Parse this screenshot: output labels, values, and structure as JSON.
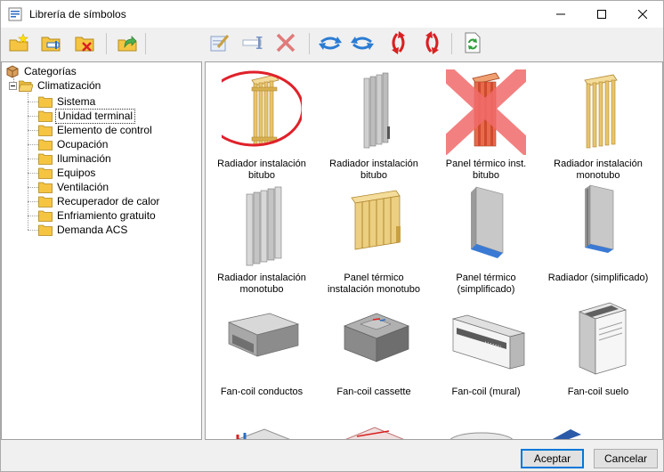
{
  "window": {
    "title": "Librería de símbolos"
  },
  "tree": {
    "root": "Categorías",
    "group": "Climatización",
    "items": [
      "Sistema",
      "Unidad terminal",
      "Elemento de control",
      "Ocupación",
      "Iluminación",
      "Equipos",
      "Ventilación",
      "Recuperador de calor",
      "Enfriamiento gratuito",
      "Demanda ACS"
    ],
    "selected": "Unidad terminal"
  },
  "symbols": [
    {
      "line1": "Radiador instalación",
      "line2": "bitubo",
      "icon": "radiator-wood-icon"
    },
    {
      "line1": "Radiador instalación",
      "line2": "bitubo",
      "icon": "radiator-grey-icon"
    },
    {
      "line1": "Panel térmico inst.",
      "line2": "bitubo",
      "icon": "panel-red-icon"
    },
    {
      "line1": "Radiador instalación",
      "line2": "monotubo",
      "icon": "radiator-wood-icon"
    },
    {
      "line1": "Radiador instalación",
      "line2": "monotubo",
      "icon": "radiator-grey-icon"
    },
    {
      "line1": "Panel térmico",
      "line2": "instalación monotubo",
      "icon": "panel-wood-icon"
    },
    {
      "line1": "Panel térmico",
      "line2": "(simplificado)",
      "icon": "panel-simple-icon"
    },
    {
      "line1": "Radiador (simplificado)",
      "line2": "",
      "icon": "radiator-simple-icon"
    },
    {
      "line1": "Fan-coil conductos",
      "line2": "",
      "icon": "fancoil-ducts-icon"
    },
    {
      "line1": "Fan-coil cassette",
      "line2": "",
      "icon": "fancoil-cassette-icon"
    },
    {
      "line1": "Fan-coil (mural)",
      "line2": "",
      "icon": "fancoil-wall-icon"
    },
    {
      "line1": "Fan-coil suelo",
      "line2": "",
      "icon": "fancoil-floor-icon"
    }
  ],
  "buttons": {
    "accept": "Aceptar",
    "cancel": "Cancelar"
  },
  "colors": {
    "highlight_circle": "#e0212a",
    "cross": "#f26b6b",
    "wood": "#e8c46a",
    "grey": "#b8b8b8",
    "accent_blue": "#0078d7"
  }
}
